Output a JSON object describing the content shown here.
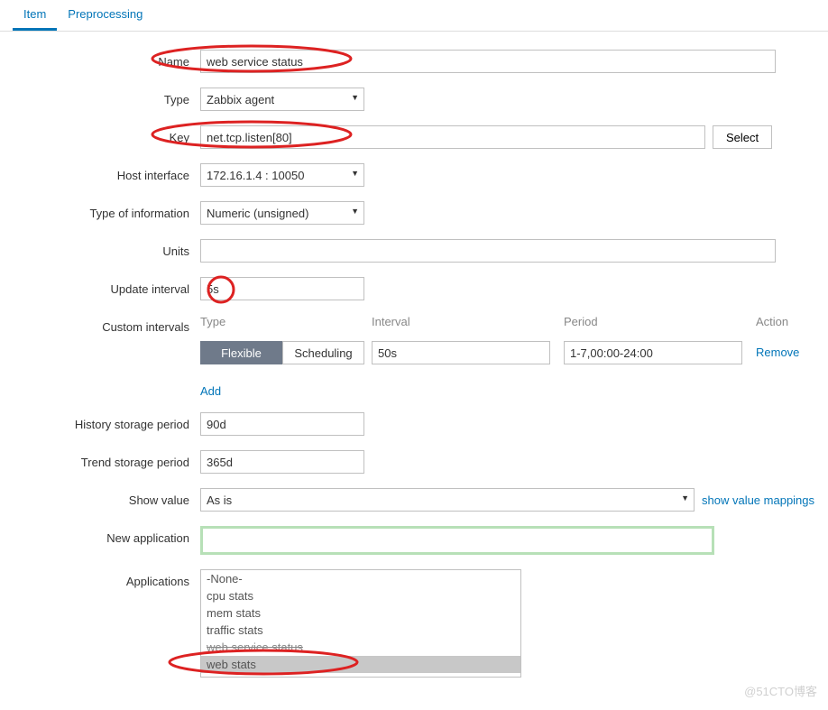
{
  "tabs": {
    "item": "Item",
    "preprocessing": "Preprocessing"
  },
  "labels": {
    "name": "Name",
    "type": "Type",
    "key": "Key",
    "host_interface": "Host interface",
    "type_of_information": "Type of information",
    "units": "Units",
    "update_interval": "Update interval",
    "custom_intervals": "Custom intervals",
    "history_storage": "History storage period",
    "trend_storage": "Trend storage period",
    "show_value": "Show value",
    "new_application": "New application",
    "applications": "Applications"
  },
  "values": {
    "name": "web service status",
    "type": "Zabbix agent",
    "key": "net.tcp.listen[80]",
    "host_interface": "172.16.1.4 : 10050",
    "type_of_information": "Numeric (unsigned)",
    "units": "",
    "update_interval": "5s",
    "history_storage": "90d",
    "trend_storage": "365d",
    "show_value": "As is",
    "new_application": ""
  },
  "custom": {
    "headers": {
      "type": "Type",
      "interval": "Interval",
      "period": "Period",
      "action": "Action"
    },
    "toggle": {
      "flexible": "Flexible",
      "scheduling": "Scheduling"
    },
    "interval": "50s",
    "period": "1-7,00:00-24:00",
    "remove": "Remove",
    "add": "Add"
  },
  "buttons": {
    "select": "Select"
  },
  "links": {
    "show_value_mappings": "show value mappings"
  },
  "applications": {
    "items": [
      "-None-",
      "cpu stats",
      "mem stats",
      "traffic stats",
      "web service status",
      "web stats"
    ],
    "selected_index": 5,
    "strike_index": 4
  },
  "watermark": "@51CTO博客"
}
